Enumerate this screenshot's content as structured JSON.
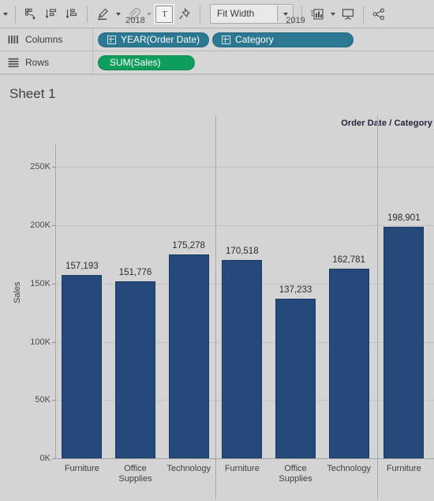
{
  "toolbar": {
    "groups": [
      {
        "items": [
          {
            "name": "overflow-caret",
            "icon": "caret-down"
          }
        ]
      },
      {
        "items": [
          {
            "name": "show-me-swap",
            "icon": "swap-rows-columns",
            "title": "Swap Rows and Columns"
          },
          {
            "name": "sort-ascending",
            "icon": "sort-ascending",
            "title": "Sort Ascending"
          },
          {
            "name": "sort-descending",
            "icon": "sort-descending",
            "title": "Sort Descending"
          }
        ]
      },
      {
        "items": [
          {
            "name": "highlighter",
            "icon": "highlighter",
            "title": "Highlighter"
          },
          {
            "name": "highlighter-caret",
            "icon": "caret-down"
          },
          {
            "name": "attach-annotation",
            "icon": "paperclip",
            "title": "Attachment"
          },
          {
            "name": "annotation-caret",
            "icon": "caret-down"
          },
          {
            "name": "text-annotation",
            "icon": "text-box",
            "title": "Text Annotation",
            "selected": true
          },
          {
            "name": "pin",
            "icon": "pushpin",
            "title": "Fix Axes"
          }
        ]
      },
      {
        "combo": {
          "name": "fit-selector",
          "value": "Fit Width"
        }
      },
      {
        "items": [
          {
            "name": "show-me-chart",
            "icon": "chart-card",
            "title": "Show Me"
          },
          {
            "name": "show-me-caret",
            "icon": "caret-down"
          },
          {
            "name": "presentation-mode",
            "icon": "presentation-screen",
            "title": "Presentation Mode"
          }
        ]
      },
      {
        "items": [
          {
            "name": "share",
            "icon": "share-nodes",
            "title": "Share"
          }
        ]
      }
    ],
    "fit_value": "Fit Width"
  },
  "shelves": {
    "columns": {
      "label": "Columns",
      "icon": "columns-icon",
      "pills": [
        {
          "label": "YEAR(Order Date)",
          "color": "blue",
          "has_plus": true
        },
        {
          "label": "Category",
          "color": "blue",
          "has_plus": true
        }
      ]
    },
    "rows": {
      "label": "Rows",
      "icon": "rows-icon",
      "pills": [
        {
          "label": "SUM(Sales)",
          "color": "green",
          "has_plus": false
        }
      ]
    }
  },
  "view": {
    "sheet_title": "Sheet 1",
    "field_caption": "Order Date / Category"
  },
  "colors": {
    "bar": "#24497a",
    "pill_blue": "#2c7792",
    "pill_green": "#0e9d5c",
    "chrome": "#d6d6d6",
    "canvas": "#d4d4d4"
  },
  "chart_data": {
    "type": "bar",
    "title": "Sheet 1",
    "xlabel": "Order Date / Category",
    "ylabel": "Sales",
    "ylim": [
      0,
      270000
    ],
    "yticks": [
      0,
      50000,
      100000,
      150000,
      200000,
      250000
    ],
    "ytick_labels": [
      "0K",
      "50K",
      "100K",
      "150K",
      "200K",
      "250K"
    ],
    "grid": true,
    "legend": "none",
    "panes": [
      {
        "year": "2018",
        "categories": [
          "Furniture",
          "Office Supplies",
          "Technology"
        ],
        "values": [
          157193,
          151776,
          175278
        ],
        "value_labels": [
          "157,193",
          "151,776",
          "175,278"
        ]
      },
      {
        "year": "2019",
        "categories": [
          "Furniture",
          "Office Supplies",
          "Technology"
        ],
        "values": [
          170518,
          137233,
          162781
        ],
        "value_labels": [
          "170,518",
          "137,233",
          "162,781"
        ]
      },
      {
        "year": "",
        "categories": [
          "Furniture"
        ],
        "values": [
          198901
        ],
        "value_labels": [
          "198,901"
        ],
        "clipped": true
      }
    ],
    "note": "Third year pane is cut off at the right edge of the viewport; only its first category (Furniture) is visible."
  }
}
